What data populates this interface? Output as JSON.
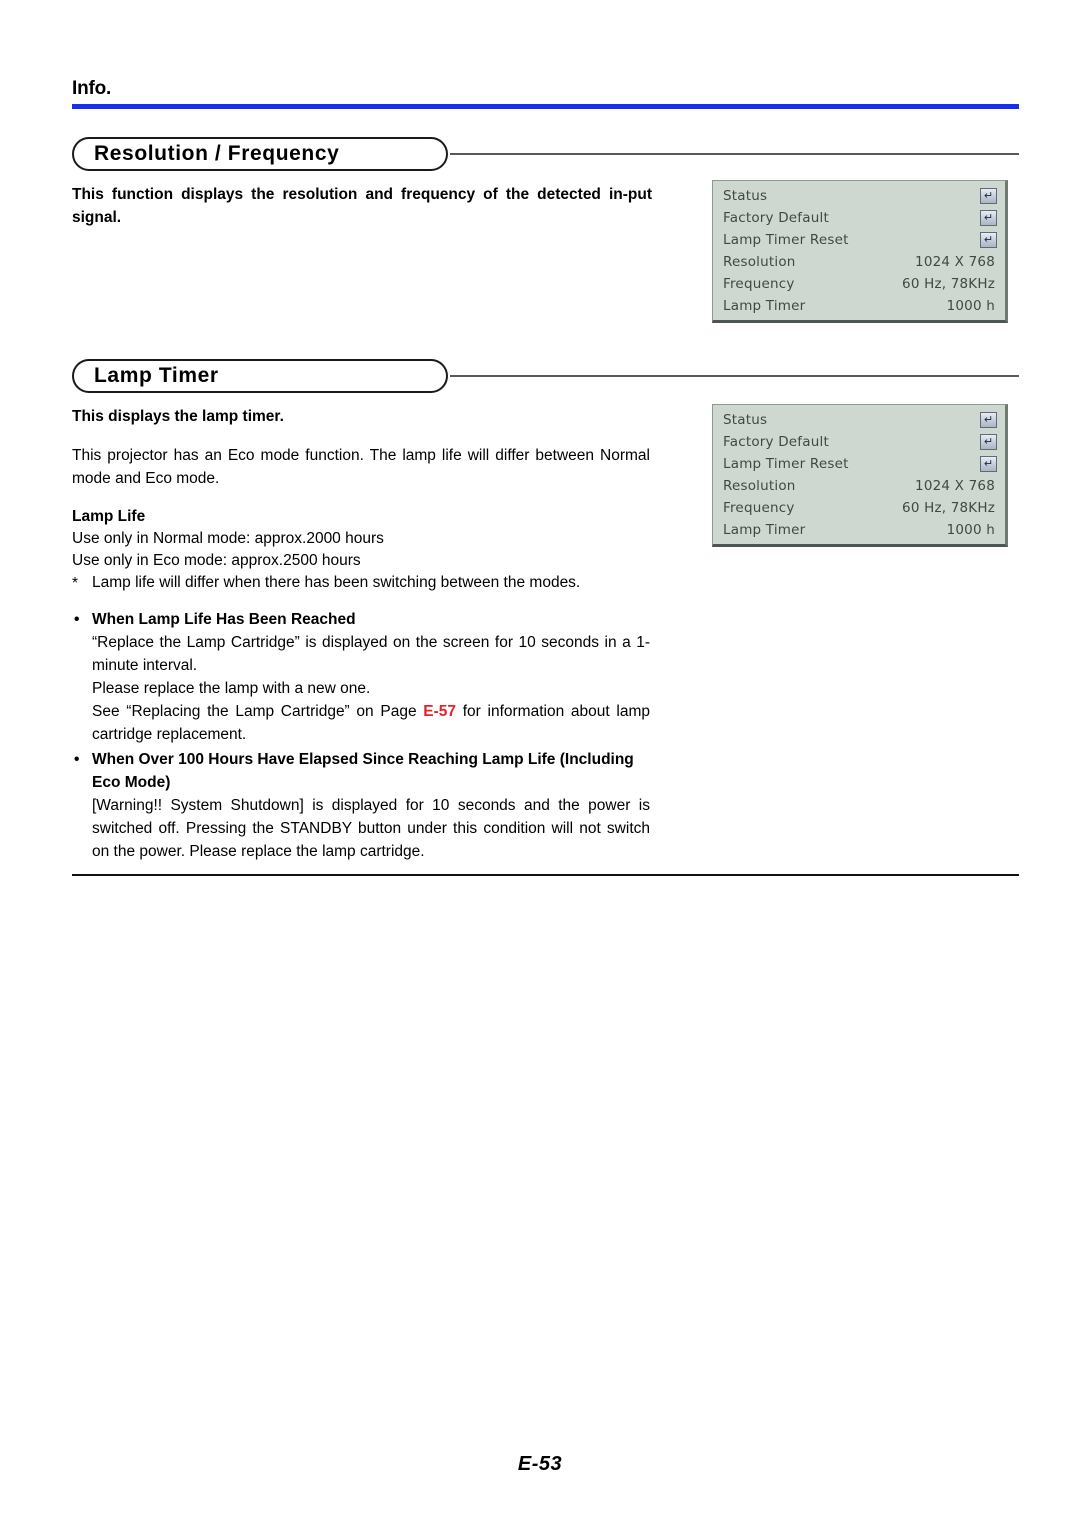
{
  "header": {
    "label": "Info.",
    "rule_color": "#1a2ef0"
  },
  "sections": [
    {
      "title": "Resolution / Frequency",
      "body": "This function displays the resolution and frequency of the detected in-put signal."
    },
    {
      "title": "Lamp Timer",
      "intro_bold": "This displays the lamp timer.",
      "intro_body": "This projector has an Eco mode function. The lamp life will differ between Normal mode and Eco mode.",
      "lamp_life_heading": "Lamp Life",
      "lamp_life_normal": "Use only in Normal mode: approx.2000 hours",
      "lamp_life_eco": "Use only in Eco mode: approx.2500 hours",
      "lamp_life_note": "Lamp life will differ when there has been switching between the modes.",
      "bullets": [
        {
          "heading": "When Lamp Life Has Been Reached",
          "body_part1": "“Replace the Lamp Cartridge” is displayed on the screen for 10 seconds in a 1-minute interval.",
          "body_part2": "Please replace the lamp with a new one.",
          "body_part3_pre": "See “Replacing the Lamp Cartridge” on Page ",
          "body_part3_link": "E-57",
          "body_part3_post": " for information about lamp cartridge replacement."
        },
        {
          "heading": "When Over 100 Hours Have Elapsed Since Reaching Lamp Life (Including Eco Mode)",
          "body": "[Warning!! System Shutdown] is displayed for 10 seconds and the power is switched off. Pressing the STANDBY button under this condition will not switch on the power. Please replace the lamp cartridge."
        }
      ]
    }
  ],
  "osd_menu": {
    "background_color": "#cfd8d0",
    "rows": [
      {
        "label": "Status",
        "value": "",
        "icon": "enter-key-icon"
      },
      {
        "label": "Factory Default",
        "value": "",
        "icon": "enter-key-icon"
      },
      {
        "label": "Lamp Timer Reset",
        "value": "",
        "icon": "enter-key-icon"
      },
      {
        "label": "Resolution",
        "value": "1024 X 768",
        "icon": ""
      },
      {
        "label": "Frequency",
        "value": "60 Hz, 78KHz",
        "icon": ""
      },
      {
        "label": "Lamp Timer",
        "value": "1000 h",
        "icon": ""
      }
    ],
    "enter_glyph": "↵"
  },
  "footer": {
    "page_number": "E-53"
  },
  "link_color": "#e8202a"
}
